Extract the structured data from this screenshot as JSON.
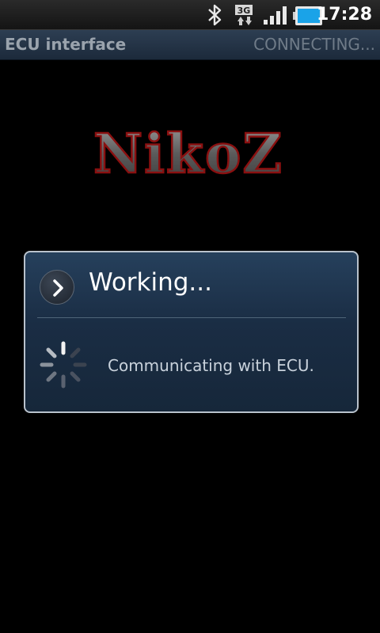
{
  "status_bar": {
    "time": "17:28",
    "network_label": "3G",
    "icons": [
      "bluetooth-icon",
      "3g-data-icon",
      "signal-strength-icon",
      "battery-icon"
    ]
  },
  "title_bar": {
    "app_title": "ECU interface",
    "connection_status": "CONNECTING..."
  },
  "logo": {
    "text": "NikoZ"
  },
  "dialog": {
    "title": "Working...",
    "message": "Communicating with ECU.",
    "icons": [
      "chevron-right-icon",
      "loading-spinner-icon"
    ]
  },
  "colors": {
    "background": "#000000",
    "title_bar": "#23344a",
    "dialog_background": "#1c3048",
    "dialog_border": "#b9c2cc",
    "logo_outline": "#8a1010"
  }
}
